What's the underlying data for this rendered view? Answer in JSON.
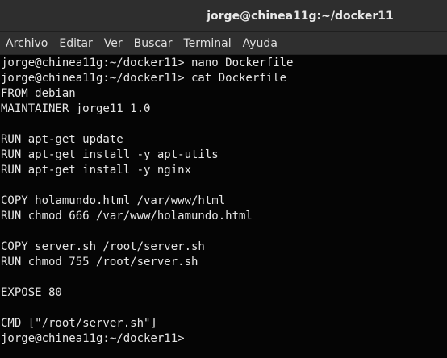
{
  "window": {
    "title": "jorge@chinea11g:~/docker11"
  },
  "menubar": {
    "items": [
      "Archivo",
      "Editar",
      "Ver",
      "Buscar",
      "Terminal",
      "Ayuda"
    ]
  },
  "terminal": {
    "lines": [
      "jorge@chinea11g:~/docker11> nano Dockerfile",
      "jorge@chinea11g:~/docker11> cat Dockerfile",
      "FROM debian",
      "MAINTAINER jorge11 1.0",
      "",
      "RUN apt-get update",
      "RUN apt-get install -y apt-utils",
      "RUN apt-get install -y nginx",
      "",
      "COPY holamundo.html /var/www/html",
      "RUN chmod 666 /var/www/holamundo.html",
      "",
      "COPY server.sh /root/server.sh",
      "RUN chmod 755 /root/server.sh",
      "",
      "EXPOSE 80",
      "",
      "CMD [\"/root/server.sh\"]",
      "jorge@chinea11g:~/docker11> "
    ]
  }
}
